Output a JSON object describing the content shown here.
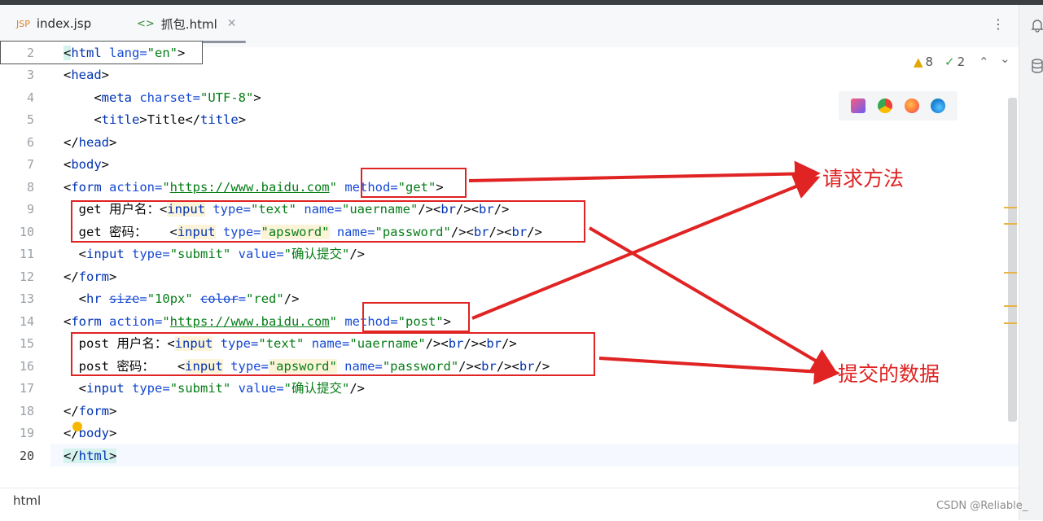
{
  "tabs": [
    {
      "icon": "JSP",
      "label": "index.jsp"
    },
    {
      "icon": "<>",
      "label": "抓包.html"
    }
  ],
  "inspections": {
    "warnings": "8",
    "checks": "2"
  },
  "line_numbers": [
    "2",
    "3",
    "4",
    "5",
    "6",
    "7",
    "8",
    "9",
    "10",
    "11",
    "12",
    "13",
    "14",
    "15",
    "16",
    "17",
    "18",
    "19",
    "20"
  ],
  "code": {
    "l2": {
      "p1": "<",
      "t1": "html",
      "a1": " lang=",
      "s1": "\"en\"",
      "p2": ">"
    },
    "l3": {
      "p1": "<",
      "t1": "head",
      "p2": ">"
    },
    "l4": {
      "ind": "    ",
      "p1": "<",
      "t1": "meta",
      "a1": " charset=",
      "s1": "\"UTF-8\"",
      "p2": ">"
    },
    "l5": {
      "ind": "    ",
      "p1": "<",
      "t1": "title",
      "p2": ">",
      "txt": "Title",
      "p3": "</",
      "t2": "title",
      "p4": ">"
    },
    "l6": {
      "p1": "</",
      "t1": "head",
      "p2": ">"
    },
    "l7": {
      "p1": "<",
      "t1": "body",
      "p2": ">"
    },
    "l8": {
      "p1": "<",
      "t1": "form",
      "a1": " action=",
      "q1": "\"",
      "u1": "https://www.baidu.com",
      "q2": "\"",
      "sp": " ",
      "a2": "method=",
      "s2": "\"get\"",
      "p2": ">"
    },
    "l9": {
      "ind": "  ",
      "txt": "get 用户名：",
      "p1": "<",
      "t1": "input",
      "a1": " type=",
      "s1": "\"text\"",
      "a2": " name=",
      "s2": "\"uaername\"",
      "p2": "/><",
      "t2": "br",
      "p3": "/><",
      "t3": "br",
      "p4": "/>"
    },
    "l10": {
      "ind": "  ",
      "txt": "get 密码：   ",
      "p1": "<",
      "t1": "input",
      "a1": " type=",
      "s1": "\"apsword\"",
      "a2": " name=",
      "s2": "\"password\"",
      "p2": "/><",
      "t2": "br",
      "p3": "/><",
      "t3": "br",
      "p4": "/>"
    },
    "l11": {
      "ind": "  ",
      "p1": "<",
      "t1": "input",
      "a1": " type=",
      "s1": "\"submit\"",
      "a2": " value=",
      "s2": "\"确认提交\"",
      "p2": "/>"
    },
    "l12": {
      "p1": "</",
      "t1": "form",
      "p2": ">"
    },
    "l13": {
      "ind": "  ",
      "p1": "<",
      "t1": "hr",
      "sp": " ",
      "a1": "size",
      "e1": "=",
      "s1": "\"10px\"",
      "sp2": " ",
      "a2": "color",
      "e2": "=",
      "s2": "\"red\"",
      "p2": "/>"
    },
    "l14": {
      "p1": "<",
      "t1": "form",
      "a1": " action=",
      "q1": "\"",
      "u1": "https://www.baidu.com",
      "q2": "\"",
      "sp": " ",
      "a2": "method=",
      "s2": "\"post\"",
      "p2": ">"
    },
    "l15": {
      "ind": "  ",
      "txt": "post 用户名：",
      "p1": "<",
      "t1": "input",
      "a1": " type=",
      "s1": "\"text\"",
      "a2": " name=",
      "s2": "\"uaername\"",
      "p2": "/><",
      "t2": "br",
      "p3": "/><",
      "t3": "br",
      "p4": "/>"
    },
    "l16": {
      "ind": "  ",
      "txt": "post 密码：   ",
      "p1": "<",
      "t1": "input",
      "a1": " type=",
      "s1": "\"apsword\"",
      "a2": " name=",
      "s2": "\"password\"",
      "p2": "/><",
      "t2": "br",
      "p3": "/><",
      "t3": "br",
      "p4": "/>"
    },
    "l17": {
      "ind": "  ",
      "p1": "<",
      "t1": "input",
      "a1": " type=",
      "s1": "\"submit\"",
      "a2": " value=",
      "s2": "\"确认提交\"",
      "p2": "/>"
    },
    "l18": {
      "p1": "</",
      "t1": "form",
      "p2": ">"
    },
    "l19": {
      "p1": "</",
      "t1": "body",
      "p2": ">"
    },
    "l20": {
      "p1": "</",
      "t1": "html",
      "p2": ">"
    }
  },
  "annotations": {
    "method_label": "请求方法",
    "data_label": "提交的数据",
    "color": "#e02323"
  },
  "status": {
    "language": "html"
  },
  "watermark": "CSDN @Reliable_",
  "icons": {
    "tab1": "jsp-file-icon",
    "tab2": "html-file-icon",
    "close": "close-icon",
    "more": "more-vertical-icon",
    "notifications": "bell-icon",
    "database": "database-icon",
    "warning": "warning-icon",
    "check": "check-icon",
    "browsers": [
      "intellij-icon",
      "chrome-icon",
      "firefox-icon",
      "edge-icon"
    ]
  }
}
